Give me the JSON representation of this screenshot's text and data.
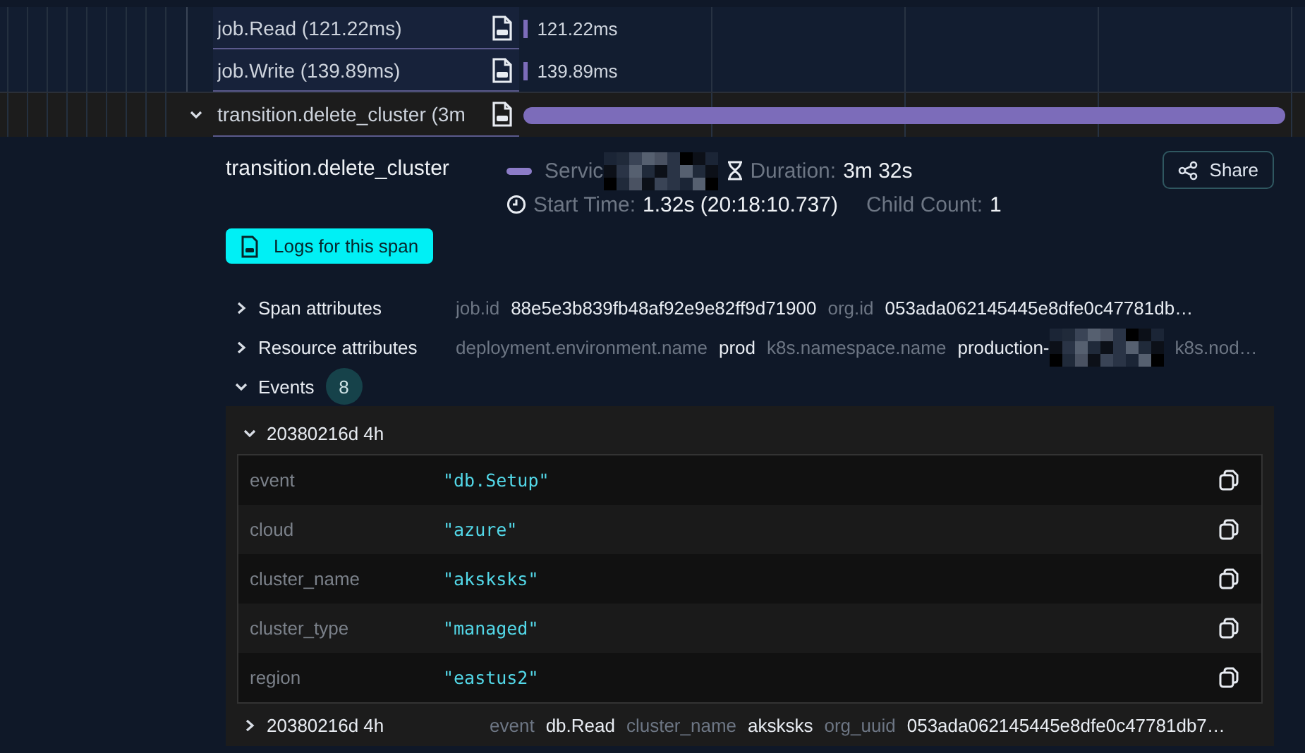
{
  "spans": [
    {
      "name": "job.Read (121.22ms)",
      "reading": "121.22ms",
      "level": 0.005,
      "selected": false
    },
    {
      "name": "job.Write (139.89ms)",
      "reading": "139.89ms",
      "level": 0.005,
      "selected": false
    },
    {
      "name": "transition.delete_cluster (3m",
      "level": 1,
      "expanded": true,
      "selected": true
    }
  ],
  "detail": {
    "title": "transition.delete_cluster",
    "service": {
      "label": "Servic",
      "redacted": true
    },
    "duration": {
      "label": "Duration:",
      "value": "3m 32s"
    },
    "start_time": {
      "label": "Start Time:",
      "value": "1.32s (20:18:10.737)"
    },
    "child_count": {
      "label": "Child Count:",
      "value": "1"
    },
    "share_button": "Share",
    "logs_button": "Logs for this span",
    "sections": [
      {
        "label": "Span attributes",
        "expanded": false,
        "attributes": [
          {
            "key": "job.id",
            "value": "88e5e3b839fb48af92e9e82ff9d71900"
          },
          {
            "key": "org.id",
            "value": "053ada062145445e8dfe0c47781db…"
          }
        ]
      },
      {
        "label": "Resource attributes",
        "expanded": false,
        "attributes": [
          {
            "key": "deployment.environment.name",
            "value": "prod"
          },
          {
            "key": "k8s.namespace.name",
            "value": "production-",
            "redacted": true
          },
          {
            "key": "k8s.nod…"
          }
        ]
      },
      {
        "label": "Events",
        "expanded": true,
        "count": "8",
        "events": [
          {
            "time": "20380216d 4h",
            "expanded": true,
            "fields": [
              {
                "key": "event",
                "value": "\"db.Setup\""
              },
              {
                "key": "cloud",
                "value": "\"azure\""
              },
              {
                "key": "cluster_name",
                "value": "\"aksksks\""
              },
              {
                "key": "cluster_type",
                "value": "\"managed\""
              },
              {
                "key": "region",
                "value": "\"eastus2\""
              }
            ]
          },
          {
            "time": "20380216d 4h",
            "expanded": false,
            "fields": [
              {
                "key": "event",
                "value": "db.Read"
              },
              {
                "key": "cluster_name",
                "value": "aksksks"
              },
              {
                "key": "org_uuid",
                "value": "053ada062145445e8dfe0c47781db7…"
              }
            ]
          }
        ]
      }
    ]
  }
}
